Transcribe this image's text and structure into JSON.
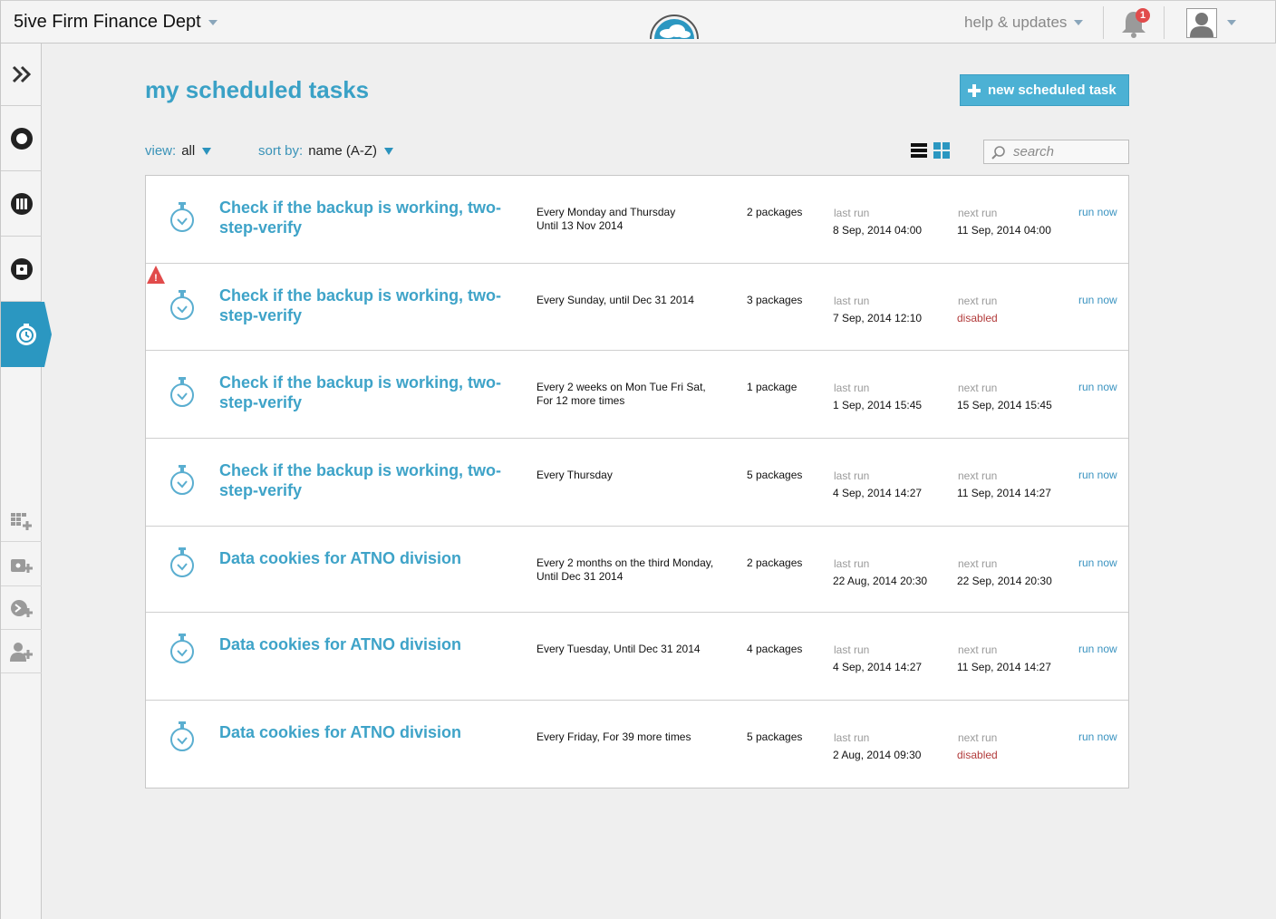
{
  "header": {
    "org_name": "5ive Firm Finance Dept",
    "help_label": "help & updates",
    "notification_count": "1"
  },
  "page": {
    "title": "my scheduled tasks",
    "new_button": "new scheduled task",
    "view_label": "view:",
    "view_value": "all",
    "sort_label": "sort by:",
    "sort_value": "name (A-Z)",
    "search_placeholder": "search"
  },
  "labels": {
    "last_run": "last run",
    "next_run": "next run",
    "run_now": "run now"
  },
  "colors": {
    "accent": "#3ea3c8",
    "sidebar_active": "#2b97c1",
    "warning": "#e14b4b",
    "disabled_text": "#b23b3b"
  },
  "tasks": [
    {
      "name": "Check if the backup is working, two-step-verify",
      "schedule_line1": "Every Monday and Thursday",
      "schedule_line2": "Until 13 Nov 2014",
      "packages": "2 packages",
      "last_run": "8 Sep, 2014 04:00",
      "next_run": "11 Sep, 2014 04:00",
      "warning": false,
      "disabled": false
    },
    {
      "name": "Check if the backup is working, two-step-verify",
      "schedule_line1": "Every Sunday, until Dec 31 2014",
      "schedule_line2": "",
      "packages": "3 packages",
      "last_run": "7 Sep, 2014 12:10",
      "next_run": "disabled",
      "warning": true,
      "disabled": true
    },
    {
      "name": "Check if the backup is working, two-step-verify",
      "schedule_line1": "Every 2 weeks on Mon Tue Fri Sat,",
      "schedule_line2": "For 12 more times",
      "packages": "1 package",
      "last_run": "1 Sep, 2014 15:45",
      "next_run": "15 Sep, 2014 15:45",
      "warning": false,
      "disabled": false
    },
    {
      "name": "Check if the backup is working, two-step-verify",
      "schedule_line1": "Every Thursday",
      "schedule_line2": "",
      "packages": "5 packages",
      "last_run": "4 Sep, 2014 14:27",
      "next_run": "11 Sep, 2014 14:27",
      "warning": false,
      "disabled": false
    },
    {
      "name": "Data cookies for ATNO division",
      "schedule_line1": "Every 2 months on the third Monday,",
      "schedule_line2": "Until Dec 31 2014",
      "packages": "2 packages",
      "last_run": "22 Aug, 2014 20:30",
      "next_run": "22 Sep, 2014 20:30",
      "warning": false,
      "disabled": false
    },
    {
      "name": "Data cookies for ATNO division",
      "schedule_line1": "Every Tuesday, Until Dec 31 2014",
      "schedule_line2": "",
      "packages": "4 packages",
      "last_run": "4 Sep, 2014 14:27",
      "next_run": "11 Sep, 2014 14:27",
      "warning": false,
      "disabled": false
    },
    {
      "name": "Data cookies for ATNO division",
      "schedule_line1": "Every Friday, For 39 more times",
      "schedule_line2": "",
      "packages": "5 packages",
      "last_run": "2 Aug, 2014 09:30",
      "next_run": "disabled",
      "warning": false,
      "disabled": true
    }
  ]
}
